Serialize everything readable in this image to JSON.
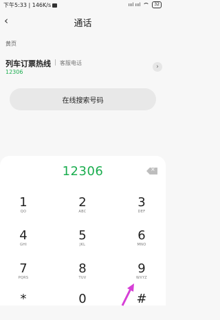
{
  "status_bar": {
    "time_speed": "下午5:33 | 146K/s",
    "signal": "ıııl ıııl",
    "battery": "32"
  },
  "header": {
    "title": "通话"
  },
  "section": {
    "label": "黄页"
  },
  "contact": {
    "name": "列车订票热线",
    "type": "客服电话",
    "number": "12306"
  },
  "search_button": {
    "label": "在线搜索号码"
  },
  "dialer": {
    "entered": "12306",
    "keys": [
      {
        "digit": "1",
        "letters": "QO"
      },
      {
        "digit": "2",
        "letters": "ABC"
      },
      {
        "digit": "3",
        "letters": "DEF"
      },
      {
        "digit": "4",
        "letters": "GHI"
      },
      {
        "digit": "5",
        "letters": "JKL"
      },
      {
        "digit": "6",
        "letters": "MNO"
      },
      {
        "digit": "7",
        "letters": "PQRS"
      },
      {
        "digit": "8",
        "letters": "TUV"
      },
      {
        "digit": "9",
        "letters": "WXYZ"
      },
      {
        "digit": "*",
        "letters": ""
      },
      {
        "digit": "0",
        "letters": ""
      },
      {
        "digit": "#",
        "letters": ""
      }
    ]
  },
  "colors": {
    "accent_green": "#1aad4e",
    "annotation_arrow": "#d63fd6"
  }
}
